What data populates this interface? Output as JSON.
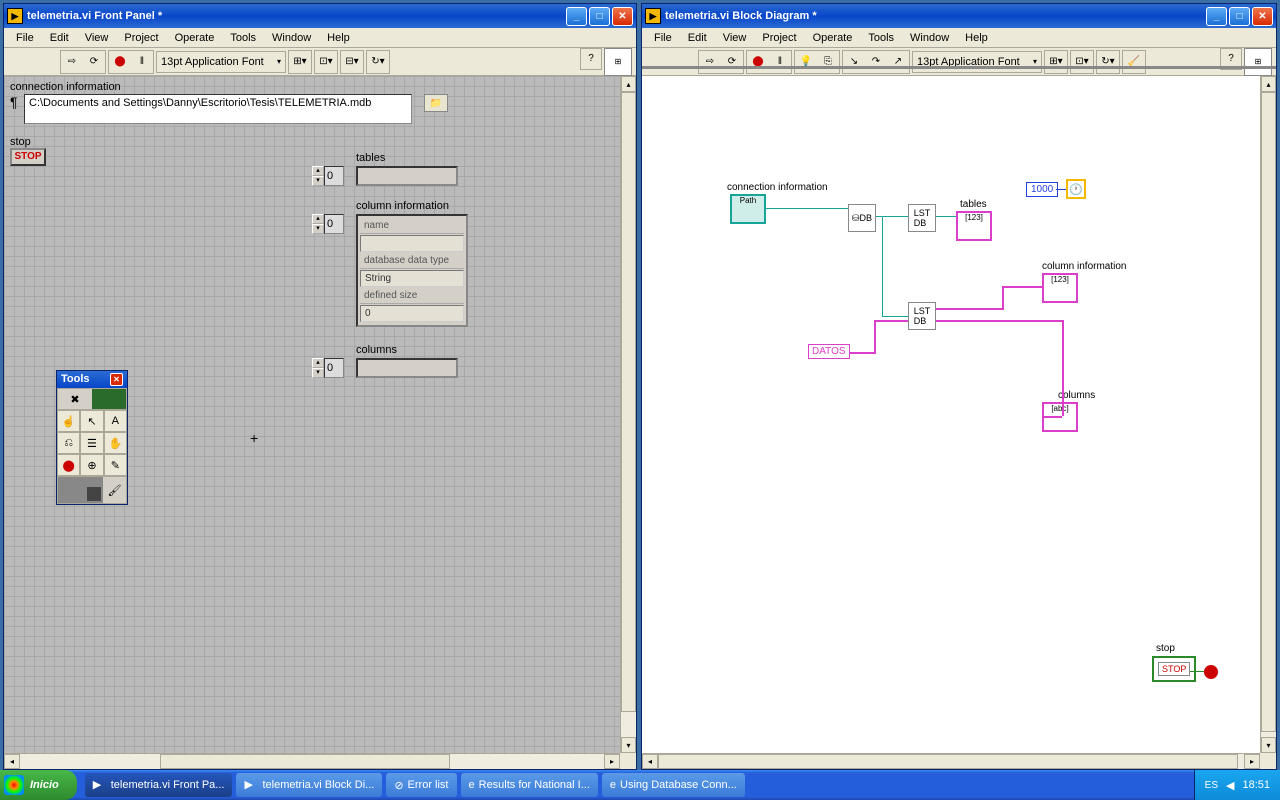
{
  "front_window": {
    "title": "telemetria.vi Front Panel *",
    "menu": [
      "File",
      "Edit",
      "View",
      "Project",
      "Operate",
      "Tools",
      "Window",
      "Help"
    ],
    "font": "13pt Application Font",
    "conn_label": "connection information",
    "conn_path": "C:\\Documents and Settings\\Danny\\Escritorio\\Tesis\\TELEMETRIA.mdb",
    "stop_label": "stop",
    "stop_btn": "STOP",
    "tables_label": "tables",
    "tables_idx": "0",
    "col_label": "column information",
    "col_idx": "0",
    "col_name_label": "name",
    "col_type_label": "database data type",
    "col_type_val": "String",
    "col_size_label": "defined size",
    "col_size_val": "0",
    "columns_label": "columns",
    "columns_idx": "0",
    "tools_title": "Tools"
  },
  "block_window": {
    "title": "telemetria.vi Block Diagram *",
    "menu": [
      "File",
      "Edit",
      "View",
      "Project",
      "Operate",
      "Tools",
      "Window",
      "Help"
    ],
    "font": "13pt Application Font",
    "conn_label": "connection information",
    "tables_label": "tables",
    "col_label": "column information",
    "columns_label": "columns",
    "datos": "DATOS",
    "num": "1000",
    "stop_label": "stop",
    "stop_text": "STOP"
  },
  "taskbar": {
    "start": "Inicio",
    "items": [
      "telemetria.vi Front Pa...",
      "telemetria.vi Block Di...",
      "Error list",
      "Results for National I...",
      "Using Database Conn..."
    ],
    "lang": "ES",
    "time": "18:51"
  }
}
